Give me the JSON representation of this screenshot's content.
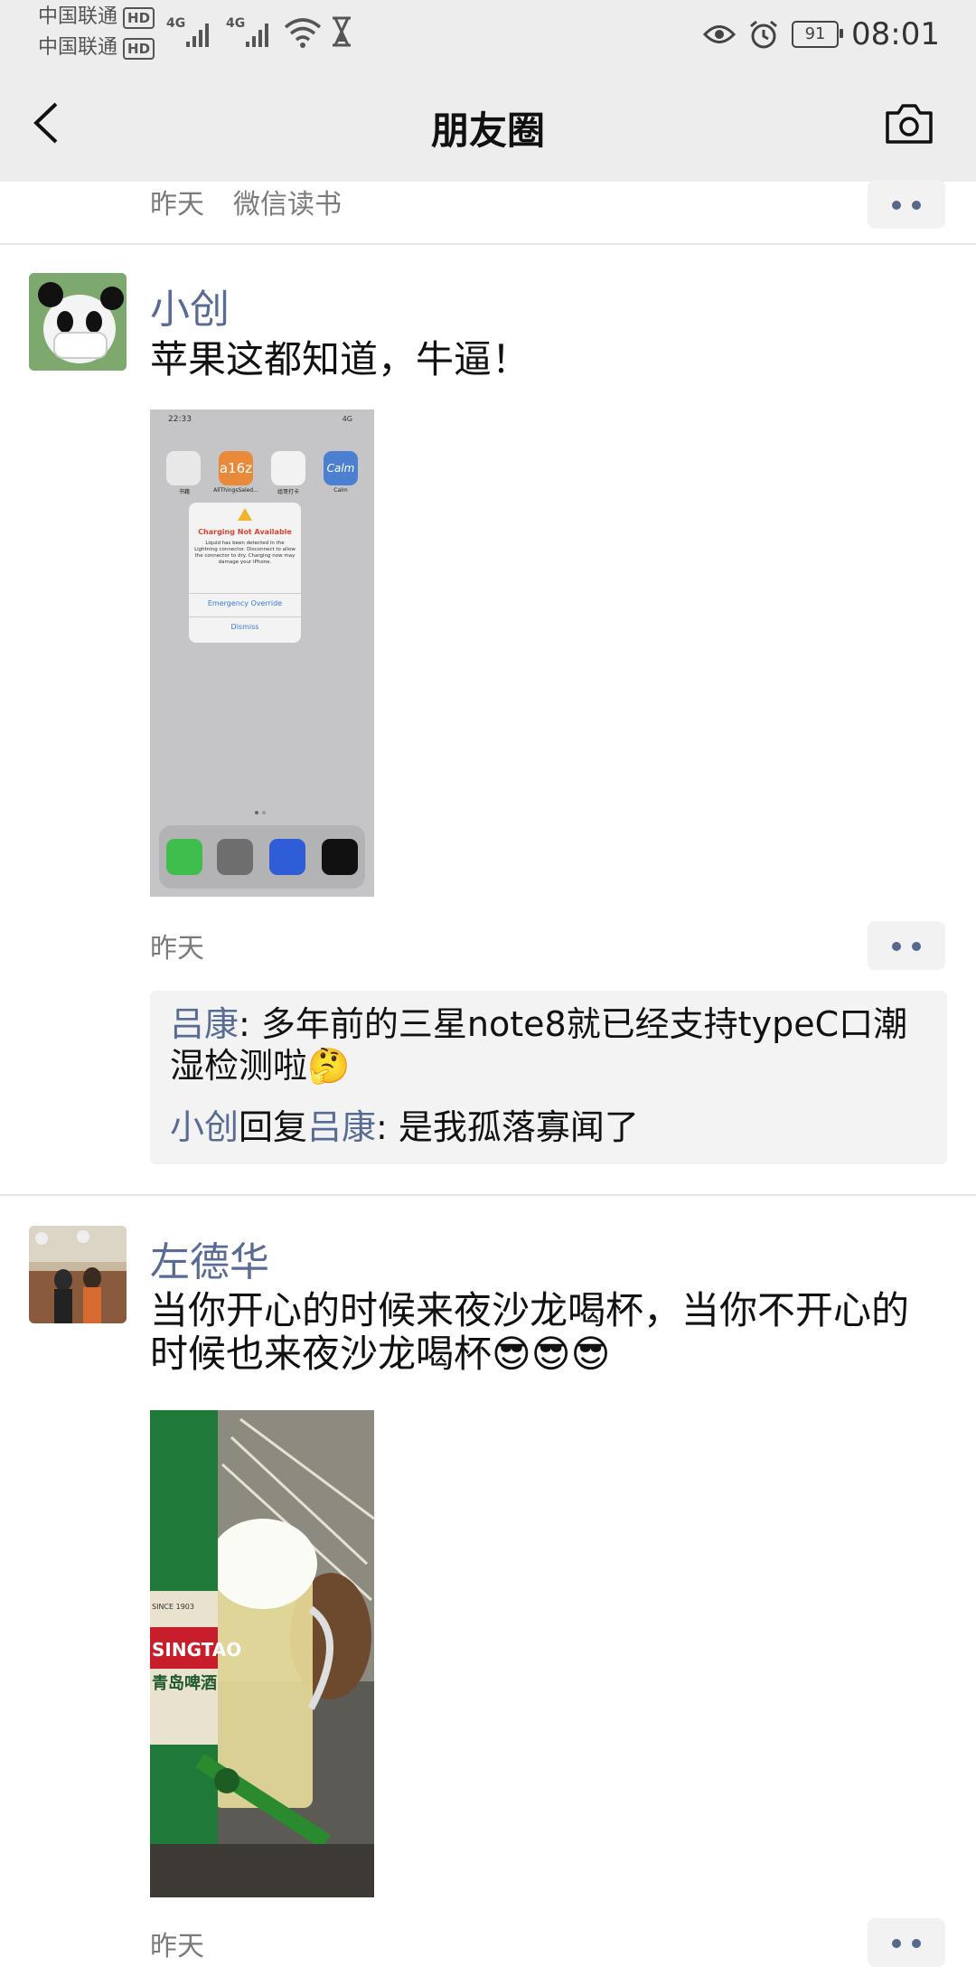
{
  "status_bar": {
    "carrier1": "中国联通",
    "carrier2": "中国联通",
    "hd1": "HD",
    "hd2": "HD",
    "network1": "4G",
    "network2": "4G",
    "battery": "91",
    "time": "08:01"
  },
  "nav": {
    "title": "朋友圈",
    "back_icon": "back-chevron-icon",
    "camera_icon": "camera-icon"
  },
  "post0": {
    "time": "昨天",
    "source": "微信读书"
  },
  "post1": {
    "name": "小创",
    "text": "苹果这都知道，牛逼！",
    "time": "昨天",
    "screenshot": {
      "time": "22:33",
      "net": "4G",
      "apps": [
        "书籍",
        "AllThingsSaled...",
        "组哥打卡",
        "Calm"
      ],
      "a16z": "a16z",
      "calm": "Calm",
      "alert_title": "Charging Not Available",
      "alert_body": "Liquid has been detected in the Lightning connector. Disconnect to allow the connector to dry. Charging now may damage your iPhone.",
      "btn1": "Emergency Override",
      "btn2": "Dismiss"
    },
    "comments": [
      {
        "name": "吕康",
        "text": ": 多年前的三星note8就已经支持typeC口潮湿检测啦🤔"
      },
      {
        "name": "小创",
        "reply": "回复",
        "target": "吕康",
        "text": ": 是我孤落寡闻了"
      }
    ]
  },
  "post2": {
    "name": "左德华",
    "text": "当你开心的时候来夜沙龙喝杯，当你不开心的时候也来夜沙龙喝杯😎😎😎",
    "time": "昨天",
    "bottle_brand": "SINGTAO",
    "bottle_cn": "青岛啤酒",
    "bottle_small": "SINCE 1903"
  },
  "colors": {
    "name_blue": "#576b95",
    "meta_gray": "#7b7b7b",
    "bar_bg": "#ededed"
  }
}
